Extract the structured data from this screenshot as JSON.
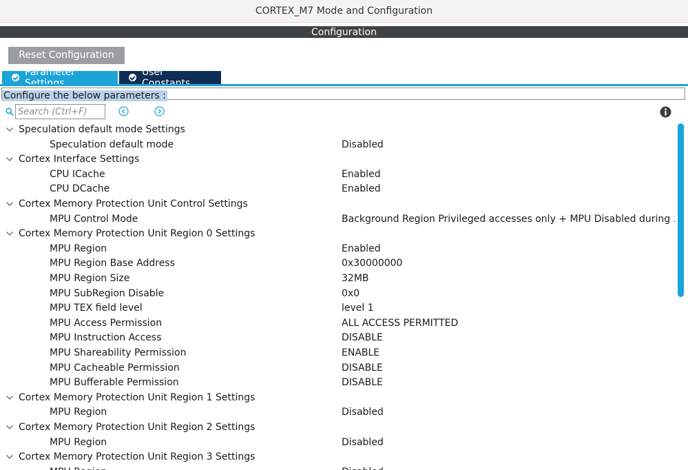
{
  "window": {
    "title": "CORTEX_M7 Mode and Configuration"
  },
  "section": {
    "title": "Configuration"
  },
  "toolbar": {
    "reset_label": "Reset Configuration"
  },
  "tabs": [
    {
      "label": "Parameter Settings",
      "active": true
    },
    {
      "label": "User Constants",
      "active": false
    }
  ],
  "config_prompt": "Configure the below parameters :",
  "search": {
    "placeholder": "Search (Ctrl+F)",
    "value": ""
  },
  "icons": {
    "search": "search-icon",
    "prev": "arrow-left-circle-icon",
    "next": "arrow-right-circle-icon",
    "info": "info-icon",
    "expand": "chevron-down-icon",
    "tab_check": "check-circle-icon"
  },
  "colors": {
    "accent": "#1ba4d8",
    "tab_inactive": "#0f2e56",
    "header_bar": "#3f4244",
    "reset_button": "#9a9ea1",
    "selection": "#b9d2ea"
  },
  "tree": [
    {
      "type": "group",
      "label": "Speculation default mode Settings"
    },
    {
      "type": "param",
      "name": "Speculation default mode",
      "value": "Disabled"
    },
    {
      "type": "group",
      "label": "Cortex Interface Settings"
    },
    {
      "type": "param",
      "name": "CPU ICache",
      "value": "Enabled"
    },
    {
      "type": "param",
      "name": "CPU DCache",
      "value": "Enabled"
    },
    {
      "type": "group",
      "label": "Cortex Memory Protection Unit Control Settings"
    },
    {
      "type": "param",
      "name": "MPU Control Mode",
      "value": "Background Region Privileged accesses only + MPU Disabled during ..."
    },
    {
      "type": "group",
      "label": "Cortex Memory Protection Unit Region 0 Settings"
    },
    {
      "type": "param",
      "name": "MPU Region",
      "value": "Enabled"
    },
    {
      "type": "param",
      "name": "MPU Region Base Address",
      "value": "0x30000000"
    },
    {
      "type": "param",
      "name": "MPU Region Size",
      "value": "32MB"
    },
    {
      "type": "param",
      "name": "MPU SubRegion Disable",
      "value": "0x0"
    },
    {
      "type": "param",
      "name": "MPU TEX field level",
      "value": "level 1"
    },
    {
      "type": "param",
      "name": "MPU Access Permission",
      "value": "ALL ACCESS PERMITTED"
    },
    {
      "type": "param",
      "name": "MPU Instruction Access",
      "value": "DISABLE"
    },
    {
      "type": "param",
      "name": "MPU Shareability Permission",
      "value": "ENABLE"
    },
    {
      "type": "param",
      "name": "MPU Cacheable Permission",
      "value": "DISABLE"
    },
    {
      "type": "param",
      "name": "MPU Bufferable  Permission",
      "value": "DISABLE"
    },
    {
      "type": "group",
      "label": "Cortex Memory Protection Unit Region 1 Settings"
    },
    {
      "type": "param",
      "name": "MPU Region",
      "value": "Disabled"
    },
    {
      "type": "group",
      "label": "Cortex Memory Protection Unit Region 2 Settings"
    },
    {
      "type": "param",
      "name": "MPU Region",
      "value": "Disabled"
    },
    {
      "type": "group",
      "label": "Cortex Memory Protection Unit Region 3 Settings"
    },
    {
      "type": "param",
      "name": "MPU Region",
      "value": "Disabled"
    }
  ]
}
